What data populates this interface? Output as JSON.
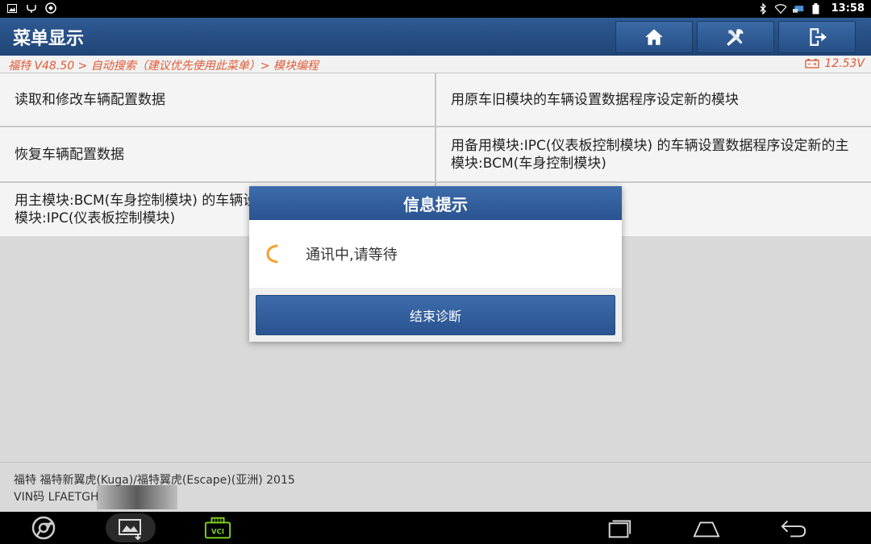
{
  "status_bar": {
    "time": "13:58",
    "left_icons": [
      "image-icon",
      "usb-icon",
      "diagnostic-app-icon"
    ],
    "right_icons": [
      "bluetooth-icon",
      "wifi-icon",
      "cast-icon",
      "battery-icon"
    ]
  },
  "header": {
    "title": "菜单显示",
    "buttons": [
      {
        "name": "home-button",
        "icon": "home-icon"
      },
      {
        "name": "tools-button",
        "icon": "tools-icon"
      },
      {
        "name": "exit-button",
        "icon": "exit-icon"
      }
    ]
  },
  "breadcrumb": {
    "path": "福特 V48.50 > 自动搜索（建议优先使用此菜单）> 模块编程",
    "voltage": "12.53V"
  },
  "menu": {
    "items": [
      {
        "label": "读取和修改车辆配置数据"
      },
      {
        "label": "用原车旧模块的车辆设置数据程序设定新的模块"
      },
      {
        "label": "恢复车辆配置数据"
      },
      {
        "label": "用备用模块:IPC(仪表板控制模块) 的车辆设置数据程序设定新的主模块:BCM(车身控制模块)"
      },
      {
        "label": "用主模块:BCM(车身控制模块) 的车辆设置数据程序设定新的备用模块:IPC(仪表板控制模块)"
      },
      {
        "label": ""
      }
    ]
  },
  "vehicle": {
    "line1": "福特 福特新翼虎(Kuga)/福特翼虎(Escape)(亚洲) 2015",
    "line2": "VIN码 LFAETGH"
  },
  "dialog": {
    "title": "信息提示",
    "message": "通讯中,请等待",
    "button_label": "结束诊断"
  },
  "nav_bar": {
    "left": [
      "chrome-icon",
      "gallery-icon",
      "vci-icon"
    ],
    "right": [
      "recent-apps-icon",
      "home-nav-icon",
      "back-icon"
    ],
    "vci_label": "VCI"
  },
  "colors": {
    "header_blue": "#1f4577",
    "breadcrumb_orange": "#e05a35",
    "spinner_orange": "#f5a030"
  }
}
